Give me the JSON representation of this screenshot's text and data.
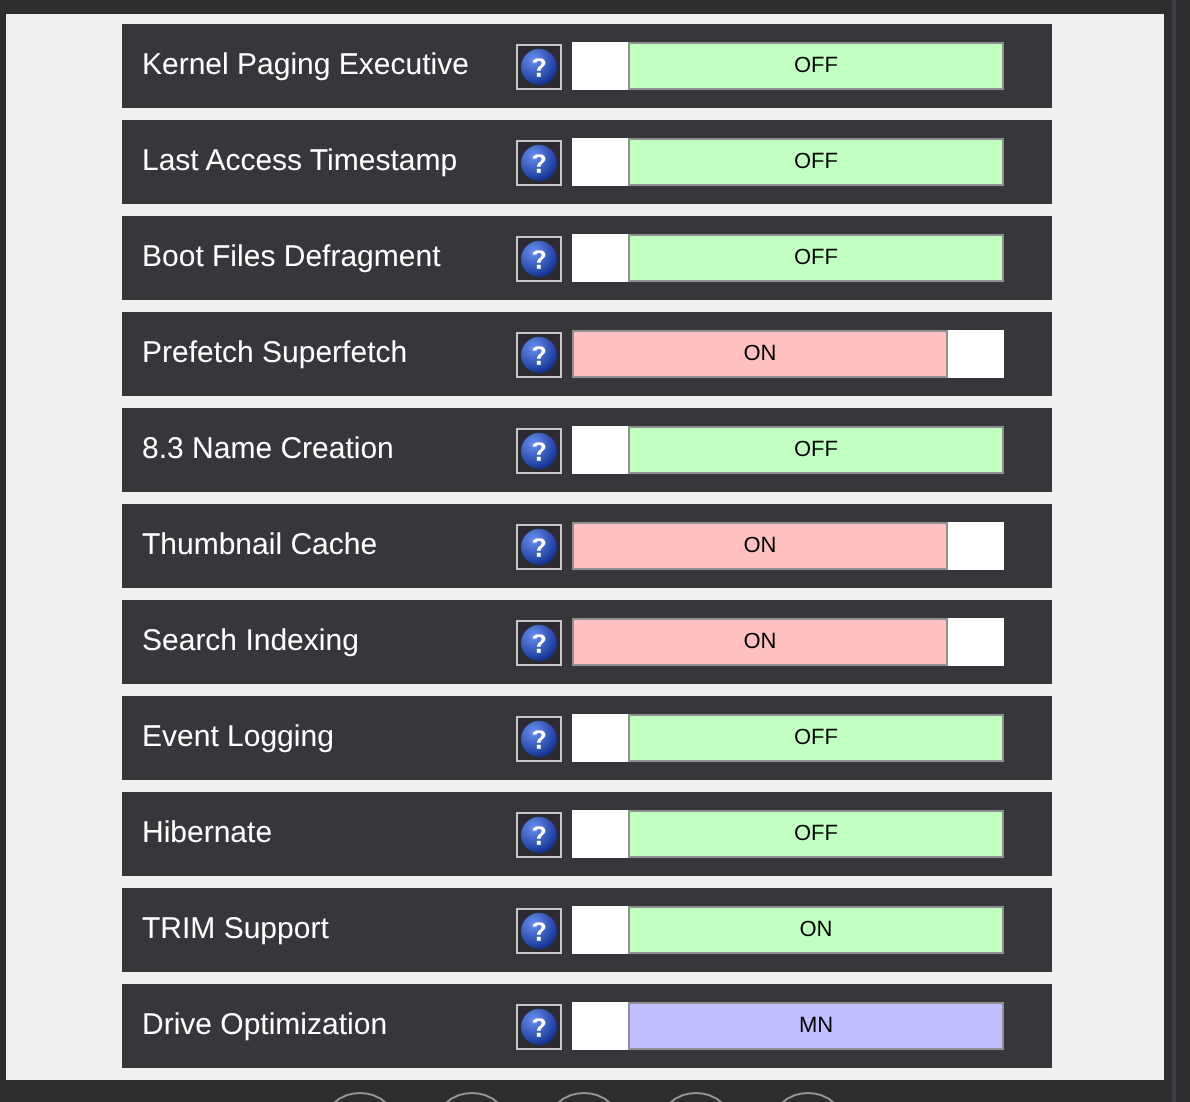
{
  "settings": [
    {
      "label": "Kernel Paging Executive",
      "value": "OFF",
      "color": "#c0ffc0",
      "toggled": false
    },
    {
      "label": "Last Access Timestamp",
      "value": "OFF",
      "color": "#c0ffc0",
      "toggled": false
    },
    {
      "label": "Boot Files Defragment",
      "value": "OFF",
      "color": "#c0ffc0",
      "toggled": false
    },
    {
      "label": "Prefetch Superfetch",
      "value": "ON",
      "color": "#ffc0c0",
      "toggled": true
    },
    {
      "label": "8.3 Name Creation",
      "value": "OFF",
      "color": "#c0ffc0",
      "toggled": false
    },
    {
      "label": "Thumbnail Cache",
      "value": "ON",
      "color": "#ffc0c0",
      "toggled": true
    },
    {
      "label": "Search Indexing",
      "value": "ON",
      "color": "#ffc0c0",
      "toggled": true
    },
    {
      "label": "Event Logging",
      "value": "OFF",
      "color": "#c0ffc0",
      "toggled": false
    },
    {
      "label": "Hibernate",
      "value": "OFF",
      "color": "#c0ffc0",
      "toggled": false
    },
    {
      "label": "TRIM Support",
      "value": "ON",
      "color": "#c0ffc0",
      "toggled": false
    },
    {
      "label": "Drive Optimization",
      "value": "MN",
      "color": "#c0c0ff",
      "toggled": false
    }
  ]
}
